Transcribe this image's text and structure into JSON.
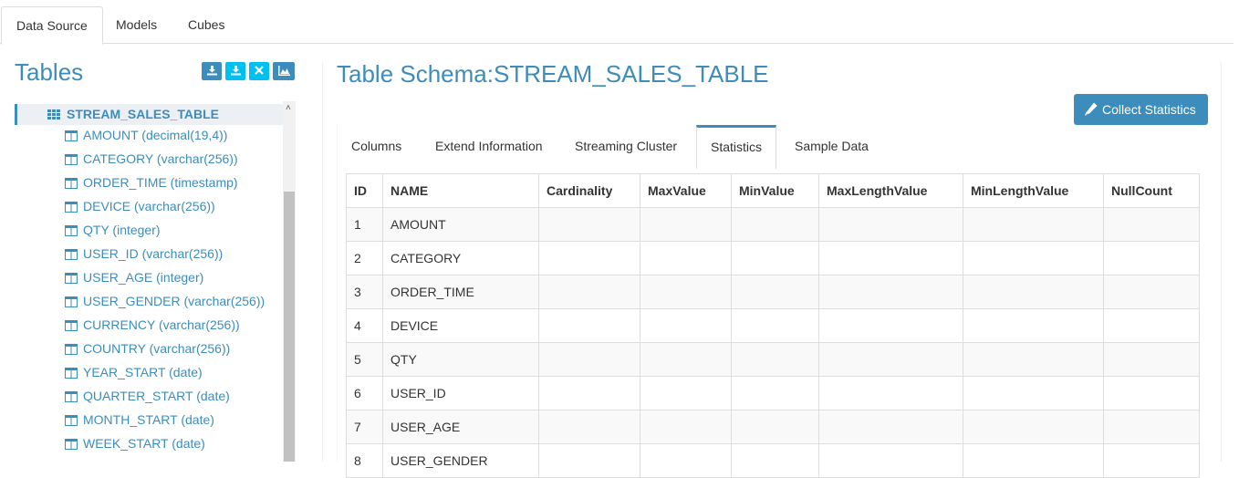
{
  "top_tabs": [
    "Data Source",
    "Models",
    "Cubes"
  ],
  "tables_panel": {
    "title": "Tables",
    "table_name": "STREAM_SALES_TABLE",
    "columns": [
      "AMOUNT (decimal(19,4))",
      "CATEGORY (varchar(256))",
      "ORDER_TIME (timestamp)",
      "DEVICE (varchar(256))",
      "QTY (integer)",
      "USER_ID (varchar(256))",
      "USER_AGE (integer)",
      "USER_GENDER (varchar(256))",
      "CURRENCY (varchar(256))",
      "COUNTRY (varchar(256))",
      "YEAR_START (date)",
      "QUARTER_START (date)",
      "MONTH_START (date)",
      "WEEK_START (date)"
    ],
    "tool_icons": [
      "load-table-icon",
      "load-table-stream-icon",
      "remove-icon",
      "chart-icon"
    ]
  },
  "schema": {
    "title": "Table Schema:STREAM_SALES_TABLE",
    "collect_button": "Collect Statistics",
    "tabs": [
      "Columns",
      "Extend Information",
      "Streaming Cluster",
      "Statistics",
      "Sample Data"
    ],
    "active_tab": "Statistics",
    "table": {
      "headers": [
        "ID",
        "NAME",
        "Cardinality",
        "MaxValue",
        "MinValue",
        "MaxLengthValue",
        "MinLengthValue",
        "NullCount"
      ],
      "rows": [
        [
          "1",
          "AMOUNT"
        ],
        [
          "2",
          "CATEGORY"
        ],
        [
          "3",
          "ORDER_TIME"
        ],
        [
          "4",
          "DEVICE"
        ],
        [
          "5",
          "QTY"
        ],
        [
          "6",
          "USER_ID"
        ],
        [
          "7",
          "USER_AGE"
        ],
        [
          "8",
          "USER_GENDER"
        ]
      ]
    }
  },
  "colors": {
    "accent": "#3c8dbc",
    "tool_blue": "#3c8dbc",
    "tool_cyan": "#00c0ef"
  }
}
